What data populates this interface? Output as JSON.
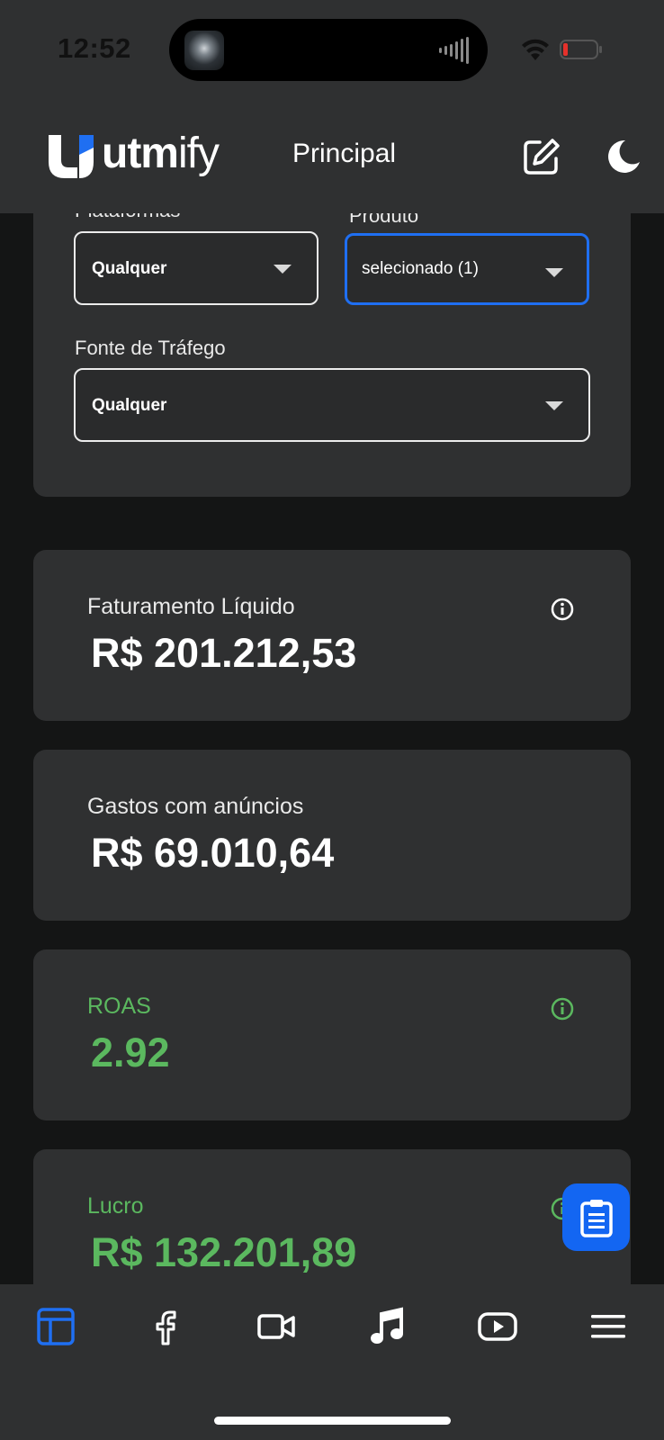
{
  "status_bar": {
    "time": "12:52"
  },
  "header": {
    "logo_text_bold": "utm",
    "logo_text_light": "ify",
    "page_title": "Principal"
  },
  "filters": {
    "platforms": {
      "label": "Plataformas",
      "value": "Qualquer"
    },
    "product": {
      "label": "Produto",
      "value": "selecionado (1)"
    },
    "traffic_source": {
      "label": "Fonte de Tráfego",
      "value": "Qualquer"
    }
  },
  "metrics": [
    {
      "label": "Faturamento Líquido",
      "value": "R$ 201.212,53",
      "has_info": true,
      "accent": false
    },
    {
      "label": "Gastos com anúncios",
      "value": "R$ 69.010,64",
      "has_info": false,
      "accent": false
    },
    {
      "label": "ROAS",
      "value": "2.92",
      "has_info": true,
      "accent": true
    },
    {
      "label": "Lucro",
      "value": "R$ 132.201,89",
      "has_info": true,
      "accent": true
    }
  ],
  "nav": {
    "items": [
      "dashboard-icon",
      "facebook-icon",
      "video-camera-icon",
      "music-note-icon",
      "youtube-icon",
      "menu-icon"
    ],
    "active_index": 0
  },
  "colors": {
    "background": "#141515",
    "card": "#2f3031",
    "accent_blue": "#1f6ff2",
    "positive_green": "#5bb85f"
  }
}
